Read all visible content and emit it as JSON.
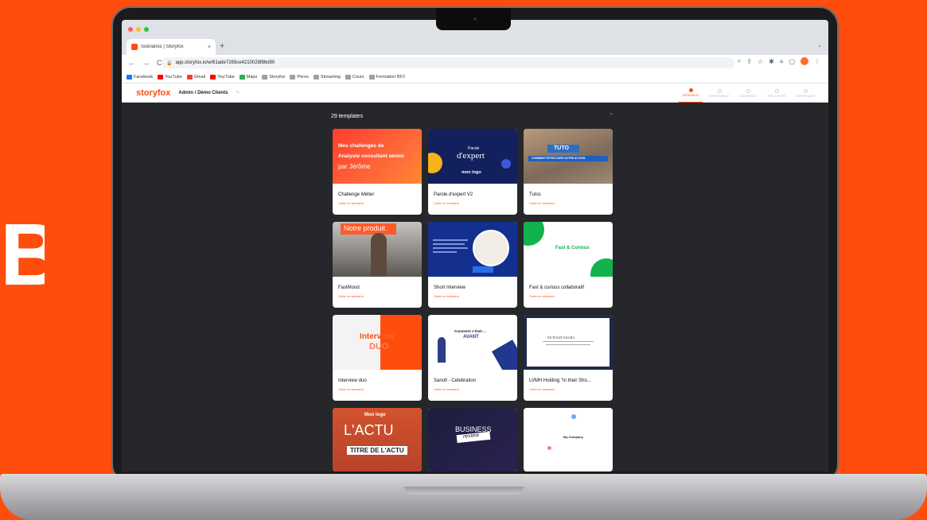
{
  "decor": {
    "big_letter": "B"
  },
  "browser": {
    "tab_title": "Scénarios | Storyfox",
    "tab_close": "×",
    "new_tab": "+",
    "url": "app.storyfox.io/w/61ade7265ce4210028f86d90",
    "bookmarks": [
      {
        "label": "Facebook",
        "color": "#1877f2"
      },
      {
        "label": "YouTube",
        "color": "#ff0000"
      },
      {
        "label": "Gmail",
        "color": "#ea4335"
      },
      {
        "label": "YouTube",
        "color": "#ff0000"
      },
      {
        "label": "Maps",
        "color": "#34a853"
      },
      {
        "label": "Storyfox",
        "color": "#9aa0a6"
      },
      {
        "label": "Perso",
        "color": "#9aa0a6"
      },
      {
        "label": "Streaming",
        "color": "#9aa0a6"
      },
      {
        "label": "Cours",
        "color": "#9aa0a6"
      },
      {
        "label": "Formation BF2",
        "color": "#9aa0a6"
      }
    ]
  },
  "app": {
    "logo": "storyfox",
    "breadcrumb": "Admin / Démo Clients",
    "nav": [
      {
        "label": "SCÉNARIOS",
        "active": true
      },
      {
        "label": "VIDÉOTHÈQUE",
        "active": false
      },
      {
        "label": "DOCUMENTS",
        "active": false
      },
      {
        "label": "MES COMPTE",
        "active": false
      },
      {
        "label": "STATISTIQUES",
        "active": false
      }
    ],
    "template_count": "29 templates",
    "cta_label": "Créer un scénario",
    "cards": [
      {
        "title": "Challenge Métier",
        "thumb_lines": [
          "Mes challenges de",
          "Analyste consultant senior",
          "par Jérôme"
        ]
      },
      {
        "title": "Parole d'expert V2",
        "thumb_lines": [
          "Parole",
          "d'expert",
          "mon logo"
        ]
      },
      {
        "title": "Tutos",
        "thumb_lines": [
          "TUTO",
          "COMMENT EFFECTUER VOTRE ACTION"
        ]
      },
      {
        "title": "FastMood",
        "thumb_lines": [
          "Notre produit"
        ]
      },
      {
        "title": "Short Interview",
        "thumb_lines": []
      },
      {
        "title": "Fast & curious collaboratif",
        "thumb_lines": [
          "Fast & Curious"
        ]
      },
      {
        "title": "Interview duo",
        "thumb_lines": [
          "Interview",
          "DUO"
        ]
      },
      {
        "title": "Sanofi - Celebration",
        "thumb_lines": [
          "Comment c'était ...",
          "AVANT"
        ]
      },
      {
        "title": "LVMH Holding \"In their Sho...",
        "thumb_lines": [
          "EN ITALIE NAGRA"
        ]
      },
      {
        "title": "",
        "thumb_lines": [
          "Mon logo",
          "L'ACTU",
          "TITRE DE L'ACTU"
        ]
      },
      {
        "title": "",
        "thumb_lines": [
          "BUSINESS",
          "review"
        ]
      },
      {
        "title": "",
        "thumb_lines": [
          "My Company"
        ]
      }
    ]
  }
}
